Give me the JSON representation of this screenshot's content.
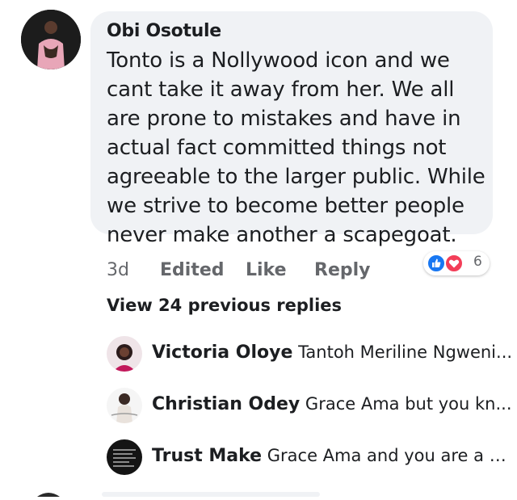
{
  "comment": {
    "author": "Obi Osotule",
    "text": "Tonto is a Nollywood icon and we cant take it away from her. We all are prone to mistakes and have in actual fact committed things not agreeable to the larger public. While we strive to become better people never make another a scapegoat.",
    "time": "3d",
    "edited_label": "Edited",
    "like_label": "Like",
    "reply_label": "Reply",
    "reaction_icons": [
      "like-reaction-icon",
      "love-reaction-icon"
    ],
    "reaction_count": "6"
  },
  "view_replies_label": "View 24 previous replies",
  "replies": [
    {
      "name": "Victoria Oloye",
      "text": "Tantoh Meriline Ngweni..."
    },
    {
      "name": "Christian Odey",
      "text": "Grace Ama  but you kn..."
    },
    {
      "name": "Trust Make",
      "text": "Grace Ama and you are a g..."
    }
  ],
  "colors": {
    "bubble": "#f0f2f5",
    "secondary_text": "#65676b",
    "like_blue": "#1877f2",
    "love_red": "#f33e58"
  }
}
